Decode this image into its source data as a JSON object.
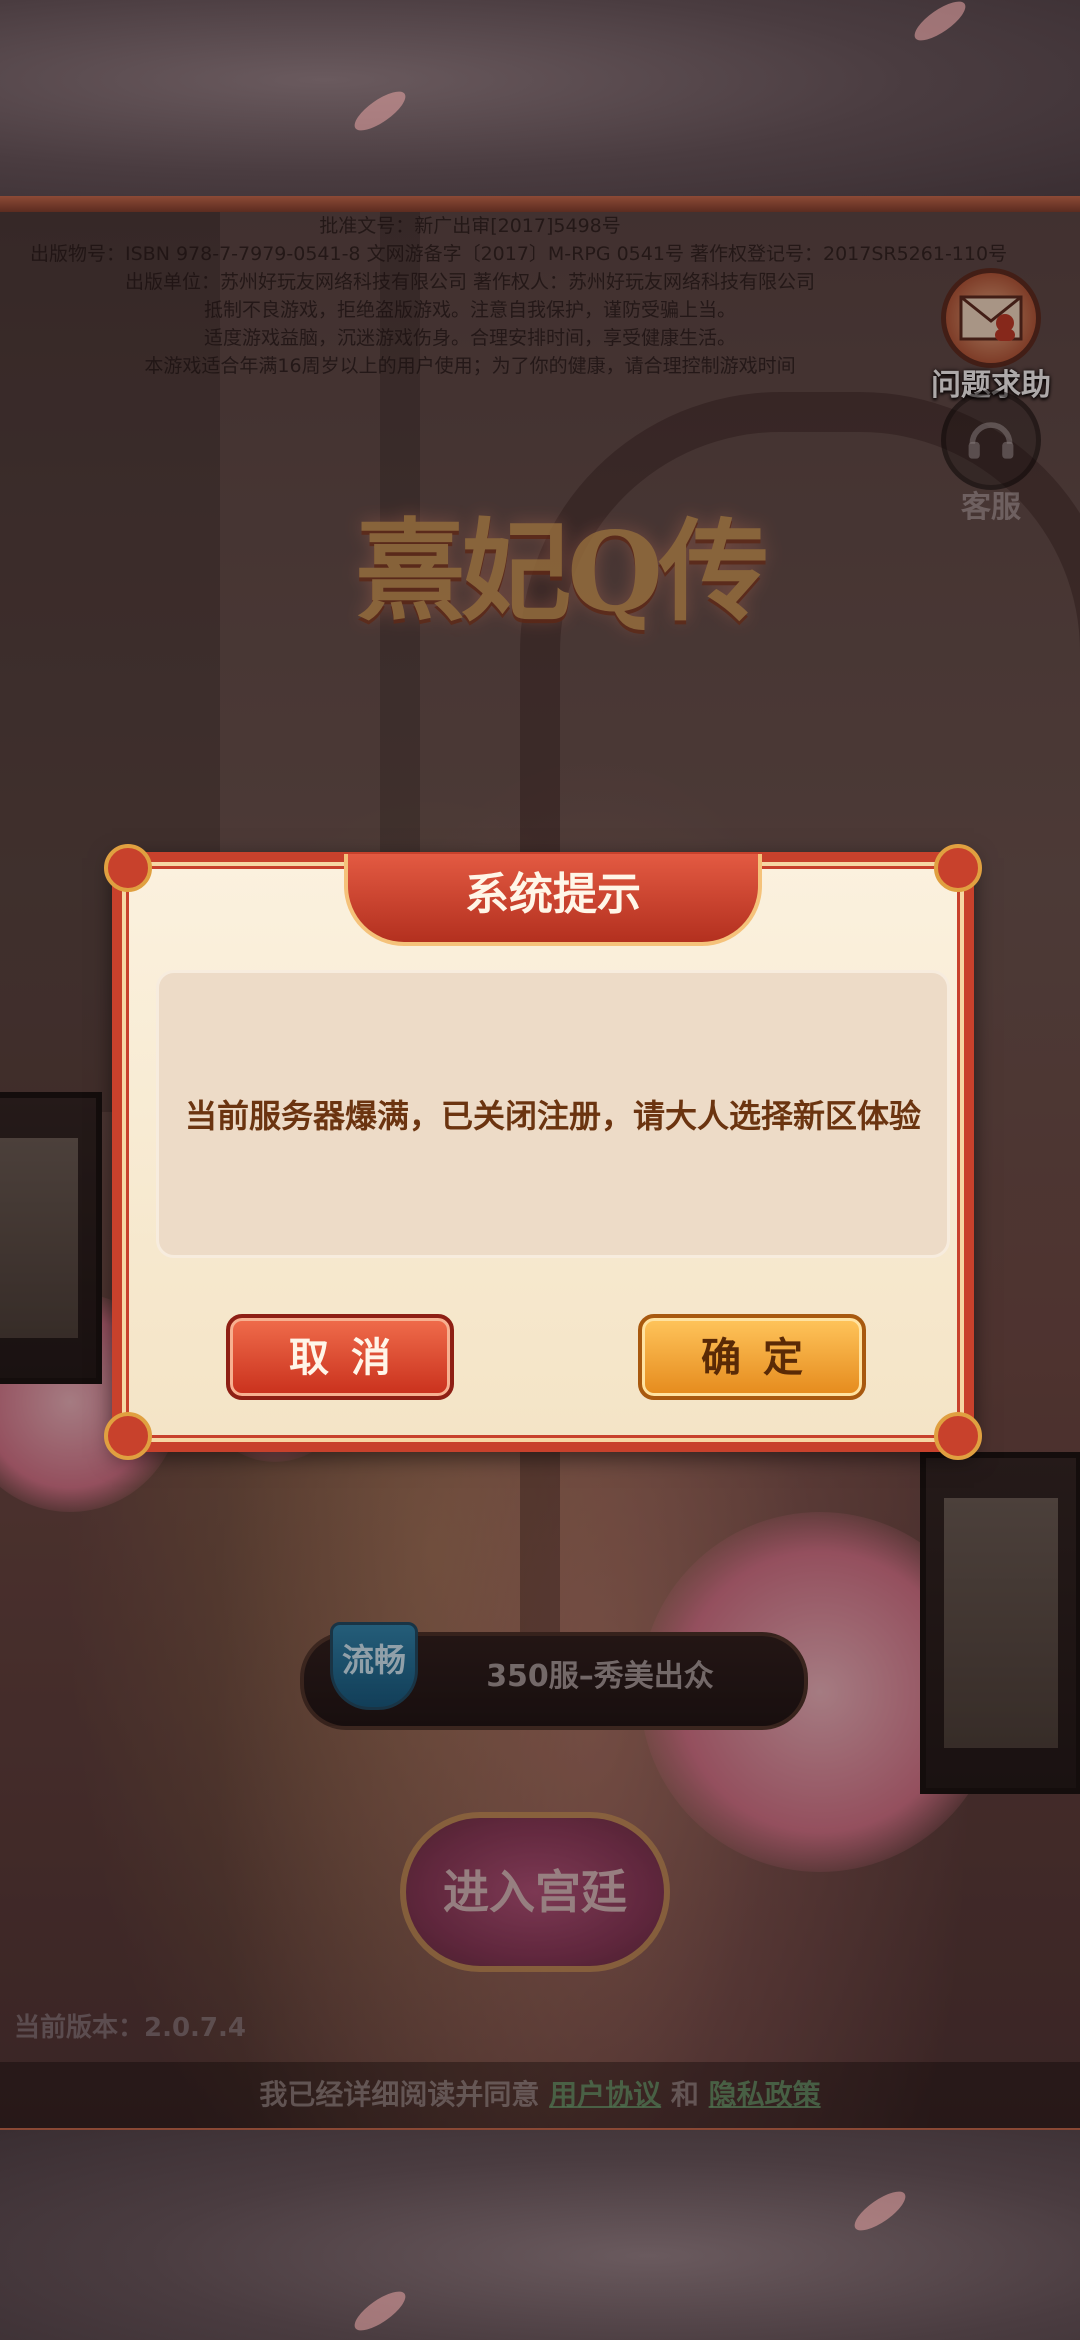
{
  "license": {
    "lines": [
      "批准文号：新广出审[2017]5498号",
      "出版物号：ISBN 978-7-7979-0541-8   文网游备字〔2017〕M-RPG 0541号   著作权登记号：2017SR5261-110号",
      "出版单位：苏州好玩友网络科技有限公司     著作权人：苏州好玩友网络科技有限公司",
      "抵制不良游戏，拒绝盗版游戏。注意自我保护，谨防受骗上当。",
      "适度游戏益脑，沉迷游戏伤身。合理安排时间，享受健康生活。",
      "本游戏适合年满16周岁以上的用户使用；为了你的健康，请合理控制游戏时间"
    ]
  },
  "game": {
    "logo_text": "熹妃Q传"
  },
  "side": {
    "help_label": "问题求助",
    "service_label": "客服"
  },
  "server": {
    "status_badge": "流畅",
    "name": "350服–秀美出众"
  },
  "enter_button": "进入宫廷",
  "version": "当前版本：2.0.7.4",
  "agreement": {
    "prefix": "我已经详细阅读并同意",
    "user_agreement": "用户协议",
    "and": "和",
    "privacy_policy": "隐私政策"
  },
  "dialog": {
    "title": "系统提示",
    "message": "当前服务器爆满，已关闭注册，请大人选择新区体验",
    "cancel_label": "取消",
    "ok_label": "确定"
  },
  "colors": {
    "dialog_border": "#c8412c",
    "cancel_button": "#c9301c",
    "ok_button": "#e58a1c",
    "message_text": "#6b3410"
  },
  "icons": [
    "help-envelope-icon",
    "headset-icon"
  ]
}
